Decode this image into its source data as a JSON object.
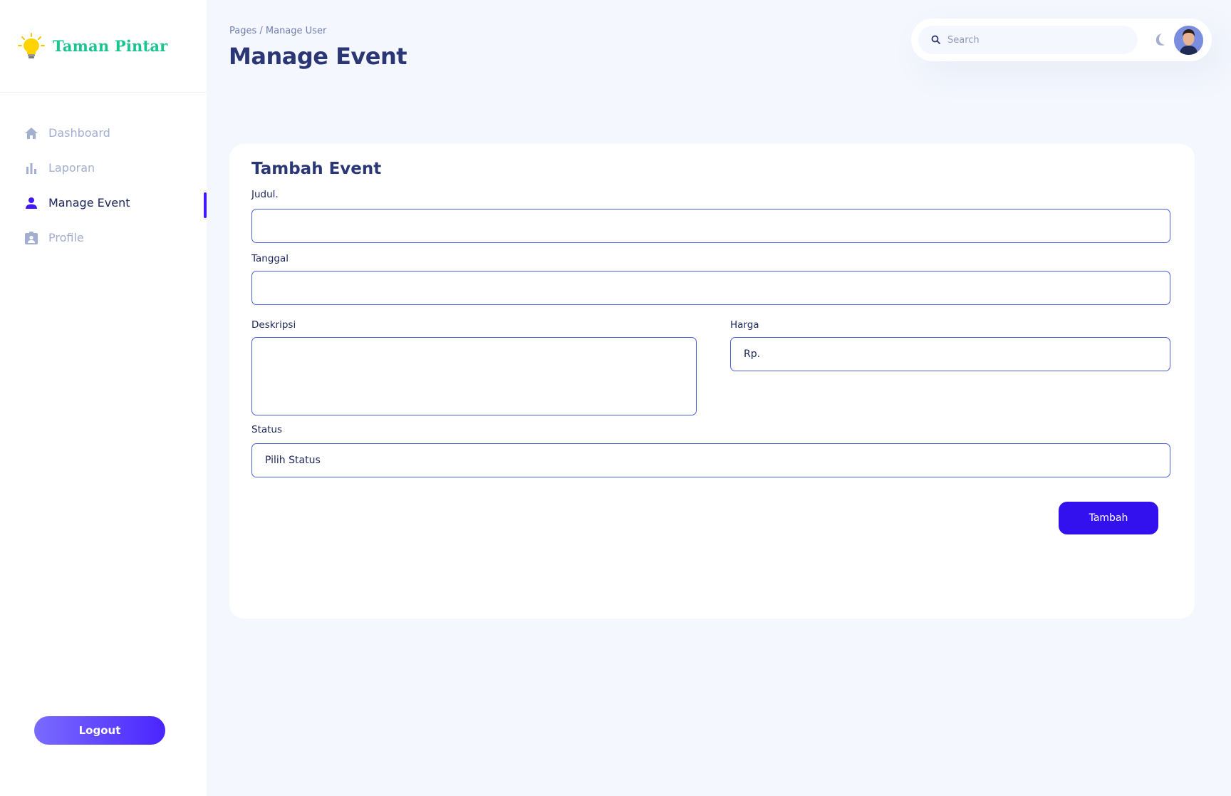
{
  "sidebar": {
    "brand_name": "Taman Pintar",
    "items": [
      {
        "label": "Dashboard",
        "icon": "home-icon",
        "active": false
      },
      {
        "label": "Laporan",
        "icon": "bar-chart-icon",
        "active": false
      },
      {
        "label": "Manage Event",
        "icon": "person-icon",
        "active": true
      },
      {
        "label": "Profile",
        "icon": "profile-badge-icon",
        "active": false
      }
    ],
    "logout_label": "Logout"
  },
  "header": {
    "breadcrumb": "Pages / Manage User",
    "title": "Manage Event",
    "search_placeholder": "Search"
  },
  "form": {
    "title": "Tambah Event",
    "judul_label": "Judul.",
    "judul_value": "",
    "tanggal_label": "Tanggal",
    "tanggal_value": "",
    "deskripsi_label": "Deskripsi",
    "deskripsi_value": "",
    "harga_label": "Harga",
    "harga_value": "Rp.",
    "status_label": "Status",
    "status_value": "Pilih Status",
    "submit_label": "Tambah"
  },
  "colors": {
    "accent": "#4318ff",
    "brand": "#19c48e",
    "text_primary": "#2b3674",
    "text_muted": "#a3aed0",
    "background": "#f4f7fe"
  }
}
